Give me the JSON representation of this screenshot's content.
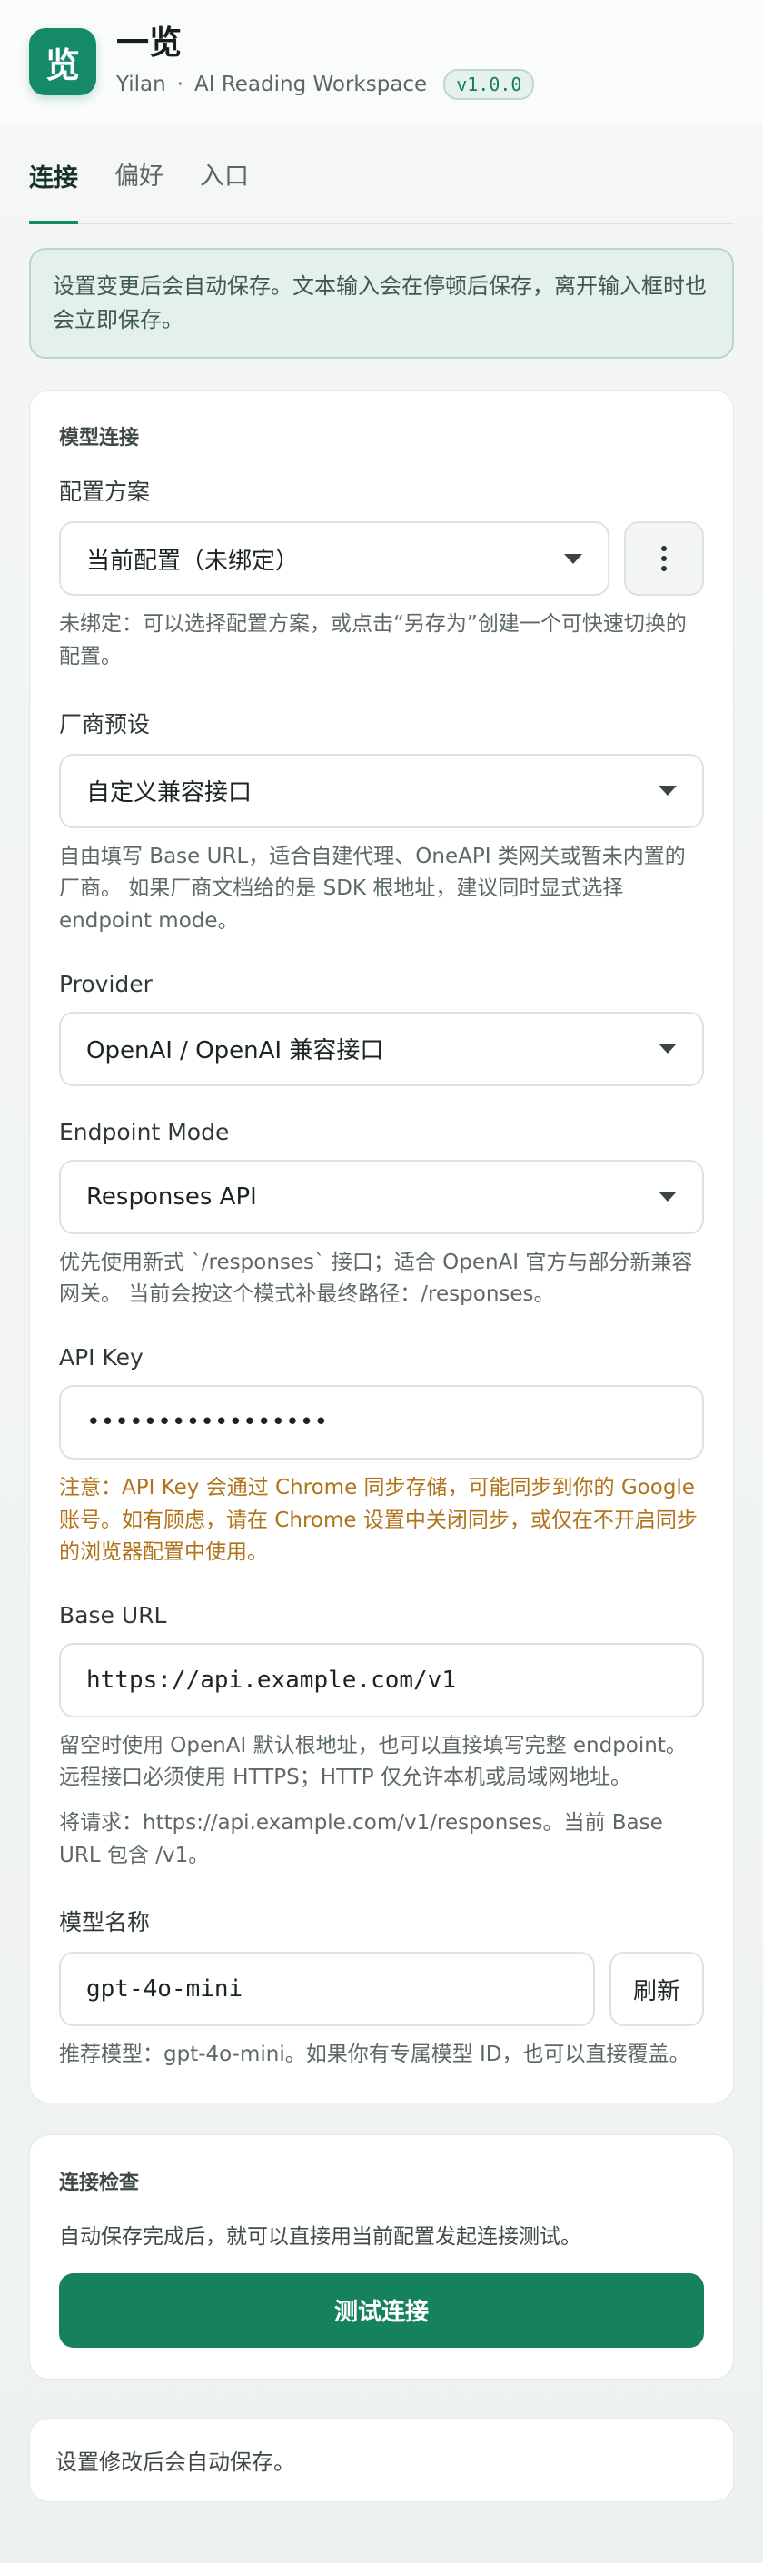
{
  "header": {
    "logo_glyph": "览",
    "app_name": "一览",
    "subtitle_left": "Yilan",
    "separator": "·",
    "subtitle_right": "AI Reading Workspace",
    "version": "v1.0.0"
  },
  "tabs": [
    {
      "label": "连接",
      "active": true
    },
    {
      "label": "偏好",
      "active": false
    },
    {
      "label": "入口",
      "active": false
    }
  ],
  "notice": "设置变更后会自动保存。文本输入会在停顿后保存，离开输入框时也会立即保存。",
  "model": {
    "section_title": "模型连接",
    "profile": {
      "label": "配置方案",
      "value": "当前配置（未绑定）",
      "help": "未绑定：可以选择配置方案，或点击“另存为”创建一个可快速切换的配置。"
    },
    "vendor": {
      "label": "厂商预设",
      "value": "自定义兼容接口",
      "help": "自由填写 Base URL，适合自建代理、OneAPI 类网关或暂未内置的厂商。 如果厂商文档给的是 SDK 根地址，建议同时显式选择 endpoint mode。"
    },
    "provider": {
      "label": "Provider",
      "value": "OpenAI / OpenAI 兼容接口"
    },
    "endpoint": {
      "label": "Endpoint Mode",
      "value": "Responses API",
      "help": "优先使用新式 `/responses` 接口；适合 OpenAI 官方与部分新兼容网关。 当前会按这个模式补最终路径：/responses。"
    },
    "api_key": {
      "label": "API Key",
      "value": "•••••••••••••••••",
      "warning": "注意：API Key 会通过 Chrome 同步存储，可能同步到你的 Google 账号。如有顾虑，请在 Chrome 设置中关闭同步，或仅在不开启同步的浏览器配置中使用。"
    },
    "base_url": {
      "label": "Base URL",
      "value": "https://api.example.com/v1",
      "help": "留空时使用 OpenAI 默认根地址，也可以直接填写完整 endpoint。远程接口必须使用 HTTPS；HTTP 仅允许本机或局域网地址。",
      "request_note": "将请求：https://api.example.com/v1/responses。当前 Base URL 包含 /v1。"
    },
    "model_name": {
      "label": "模型名称",
      "value": "gpt-4o-mini",
      "refresh_label": "刷新",
      "help": "推荐模型：gpt-4o-mini。如果你有专属模型 ID，也可以直接覆盖。"
    }
  },
  "connection": {
    "section_title": "连接检查",
    "description": "自动保存完成后，就可以直接用当前配置发起连接测试。",
    "test_button": "测试连接"
  },
  "footer_note": "设置修改后会自动保存。",
  "colors": {
    "accent": "#158a68",
    "primary_button": "#16815f",
    "warning_text": "#b0731a",
    "notice_bg": "#e4f0ea"
  },
  "icons": {
    "profile_menu": "more-vertical-icon",
    "select_caret": "chevron-down-icon"
  }
}
